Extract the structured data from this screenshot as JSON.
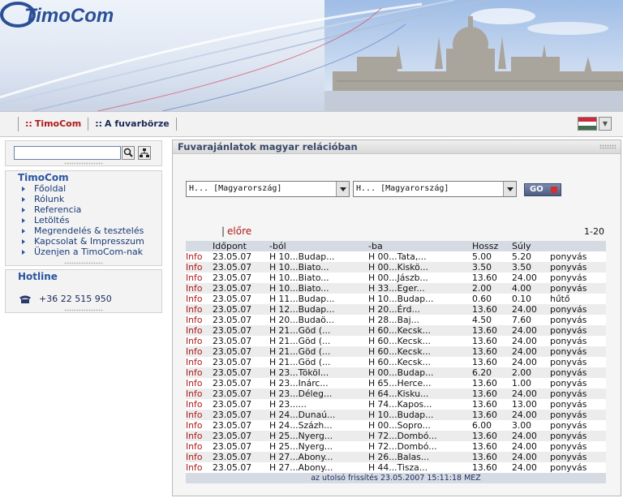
{
  "brand": {
    "logo_text": "TimoCom"
  },
  "nav": {
    "dots": "::",
    "items": [
      "TimoCom",
      "A fuvarbörze"
    ]
  },
  "language": {
    "flag_colors": [
      "#cd2a3e",
      "#ffffff",
      "#436f4d"
    ]
  },
  "sidebar": {
    "search": {
      "value": ""
    },
    "menu_title": "TimoCom",
    "menu_items": [
      "Főoldal",
      "Rólunk",
      "Referencia",
      "Letöltés",
      "Megrendelés & tesztelés",
      "Kapcsolat & Impresszum",
      "Üzenjen a TimoCom-nak"
    ],
    "hotline_title": "Hotline",
    "phone": "+36 22 515 950"
  },
  "main": {
    "title": "Fuvarajánlatok magyar relációban",
    "from_select": "H... [Magyarország]",
    "to_select": "H... [Magyarország]",
    "go_label": "GO",
    "pager_separator": "|",
    "prev_label": "előre",
    "range": "1-20",
    "columns": [
      "",
      "Időpont",
      "-ból",
      "-ba",
      "Hossz",
      "Súly",
      ""
    ],
    "rows": [
      [
        "Info",
        "23.05.07",
        "H 10...Budap...",
        "H 00...Tata,...",
        "5.00",
        "5.20",
        "ponyvás"
      ],
      [
        "Info",
        "23.05.07",
        "H 10...Biato...",
        "H 00...Kiskö...",
        "3.50",
        "3.50",
        "ponyvás"
      ],
      [
        "Info",
        "23.05.07",
        "H 10...Biato...",
        "H 00...Jászb...",
        "13.60",
        "24.00",
        "ponyvás"
      ],
      [
        "Info",
        "23.05.07",
        "H 10...Biato...",
        "H 33...Eger...",
        "2.00",
        "4.00",
        "ponyvás"
      ],
      [
        "Info",
        "23.05.07",
        "H 11...Budap...",
        "H 10...Budap...",
        "0.60",
        "0.10",
        "hűtő"
      ],
      [
        "Info",
        "23.05.07",
        "H 12...Budap...",
        "H 20...Érd...",
        "13.60",
        "24.00",
        "ponyvás"
      ],
      [
        "Info",
        "23.05.07",
        "H 20...Budaö...",
        "H 28...Baj...",
        "4.50",
        "7.60",
        "ponyvás"
      ],
      [
        "Info",
        "23.05.07",
        "H 21...Göd (...",
        "H 60...Kecsk...",
        "13.60",
        "24.00",
        "ponyvás"
      ],
      [
        "Info",
        "23.05.07",
        "H 21...Göd (...",
        "H 60...Kecsk...",
        "13.60",
        "24.00",
        "ponyvás"
      ],
      [
        "Info",
        "23.05.07",
        "H 21...Göd (...",
        "H 60...Kecsk...",
        "13.60",
        "24.00",
        "ponyvás"
      ],
      [
        "Info",
        "23.05.07",
        "H 21...Göd (...",
        "H 60...Kecsk...",
        "13.60",
        "24.00",
        "ponyvás"
      ],
      [
        "Info",
        "23.05.07",
        "H 23...Tököl...",
        "H 00...Budap...",
        "6.20",
        "2.00",
        "ponyvás"
      ],
      [
        "Info",
        "23.05.07",
        "H 23...Inárc...",
        "H 65...Herce...",
        "13.60",
        "1.00",
        "ponyvás"
      ],
      [
        "Info",
        "23.05.07",
        "H 23...Déleg...",
        "H 64...Kisku...",
        "13.60",
        "24.00",
        "ponyvás"
      ],
      [
        "Info",
        "23.05.07",
        "H 23......",
        "H 74...Kapos...",
        "13.60",
        "13.00",
        "ponyvás"
      ],
      [
        "Info",
        "23.05.07",
        "H 24...Dunaú...",
        "H 10...Budap...",
        "13.60",
        "24.00",
        "ponyvás"
      ],
      [
        "Info",
        "23.05.07",
        "H 24...Százh...",
        "H 00...Sopro...",
        "6.00",
        "3.00",
        "ponyvás"
      ],
      [
        "Info",
        "23.05.07",
        "H 25...Nyerg...",
        "H 72...Dombó...",
        "13.60",
        "24.00",
        "ponyvás"
      ],
      [
        "Info",
        "23.05.07",
        "H 25...Nyerg...",
        "H 72...Dombó...",
        "13.60",
        "24.00",
        "ponyvás"
      ],
      [
        "Info",
        "23.05.07",
        "H 27...Abony...",
        "H 26...Balas...",
        "13.60",
        "24.00",
        "ponyvás"
      ],
      [
        "Info",
        "23.05.07",
        "H 27...Abony...",
        "H 44...Tisza...",
        "13.60",
        "24.00",
        "ponyvás"
      ]
    ],
    "footer": "az utolsó frissítés 23.05.2007 15:11:18 MEZ"
  }
}
